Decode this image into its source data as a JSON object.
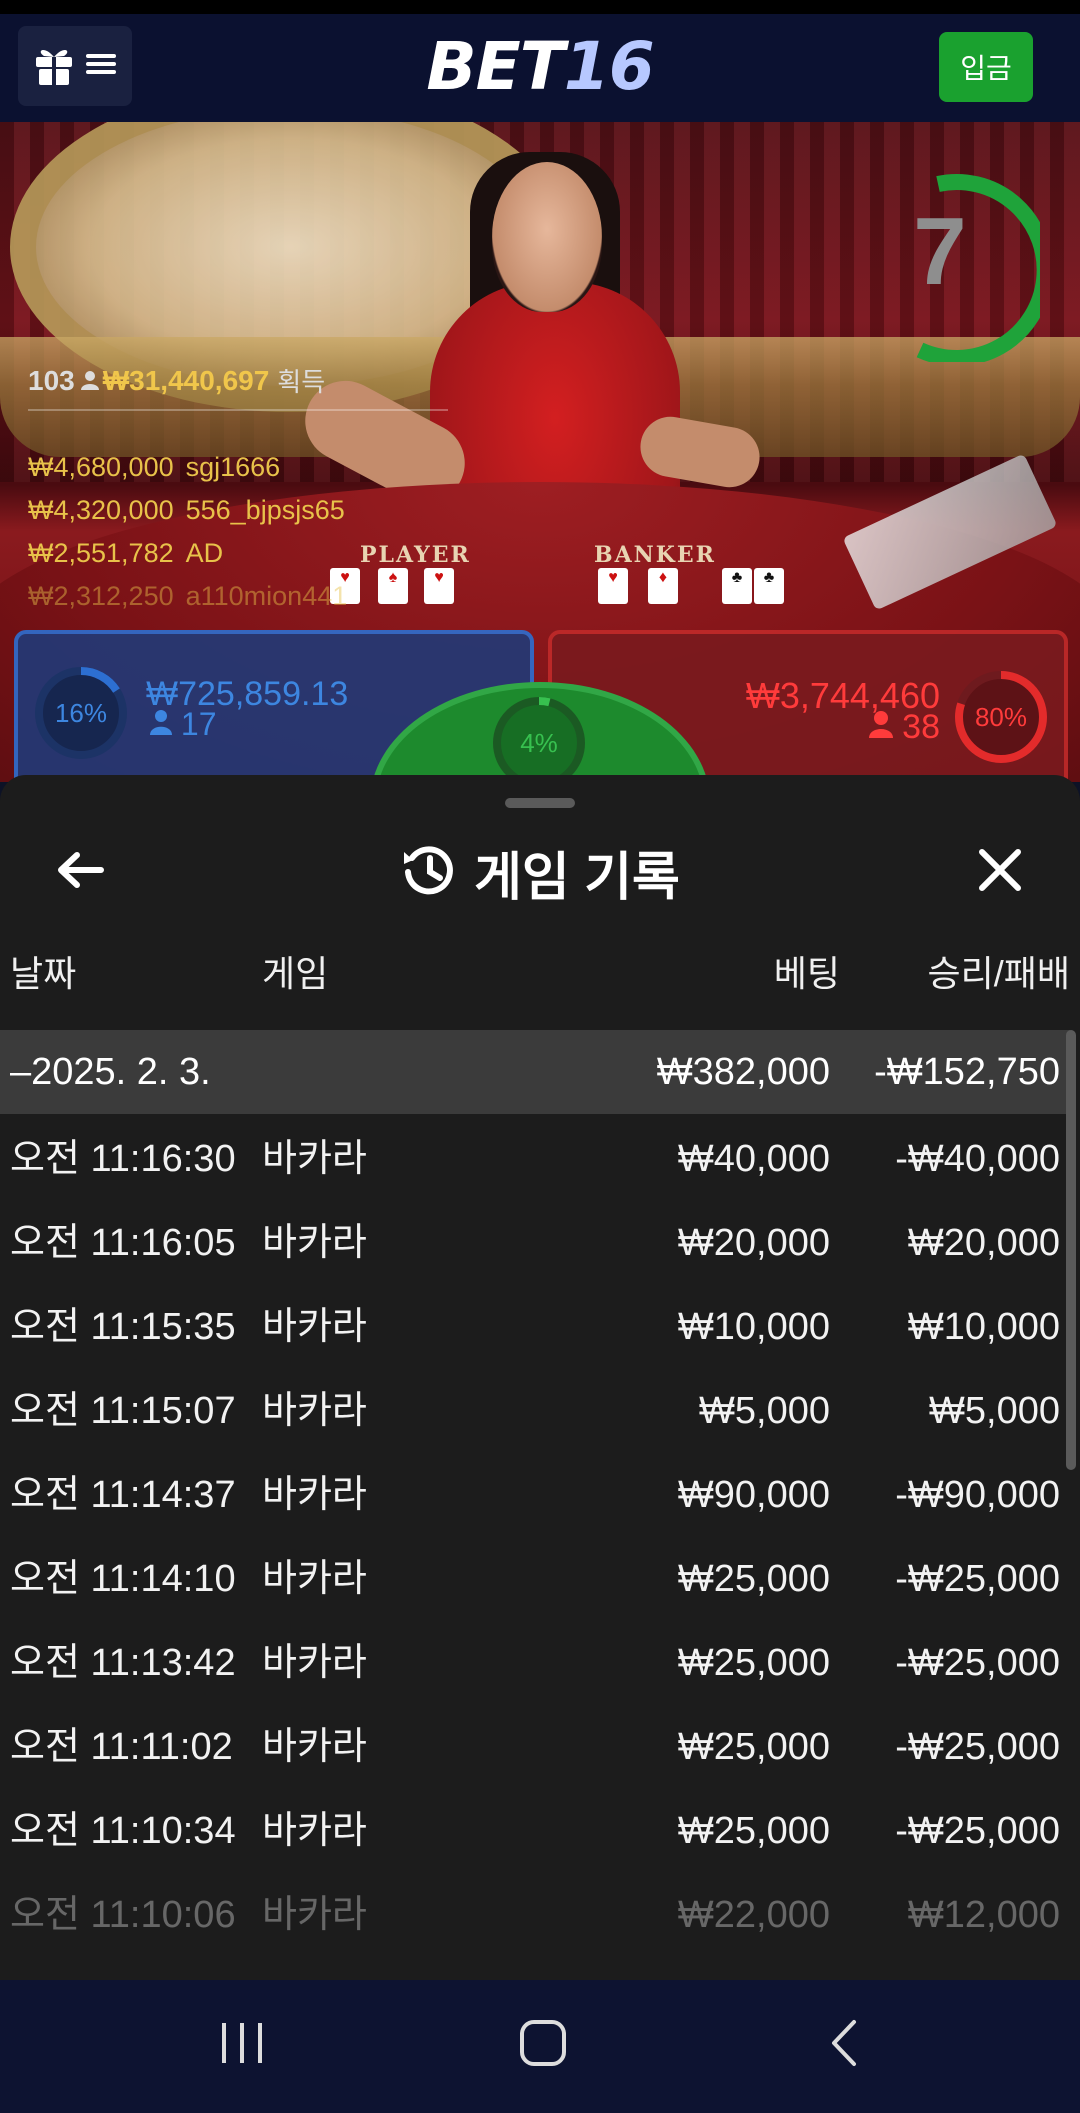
{
  "header": {
    "logo_bet": "BET",
    "logo_num": "16",
    "deposit_label": "입금"
  },
  "video": {
    "timer": "7",
    "table_player_label": "PLAYER",
    "table_banker_label": "BANKER",
    "winners": {
      "count": "103",
      "total": "₩31,440,697",
      "total_label": "획득",
      "list": [
        {
          "amount": "₩4,680,000",
          "name": "sgj1666"
        },
        {
          "amount": "₩4,320,000",
          "name": "556_bjpsjs65"
        },
        {
          "amount": "₩2,551,782",
          "name": "AD"
        },
        {
          "amount": "₩2,312,250",
          "name": "a110mion441"
        }
      ]
    },
    "player_bet": {
      "percent_label": "16%",
      "percent": 16,
      "amount": "₩725,859.13",
      "count": "17"
    },
    "tie_bet": {
      "percent_label": "4%",
      "percent": 4
    },
    "banker_bet": {
      "percent_label": "80%",
      "percent": 80,
      "amount": "₩3,744,460",
      "count": "38"
    },
    "colors": {
      "player": "#2d6fd1",
      "banker": "#c12a2a",
      "tie": "#31a746",
      "timer": "#1fa33a",
      "gold": "#f0c64b"
    }
  },
  "history": {
    "title": "게임 기록",
    "columns": {
      "date": "날짜",
      "game": "게임",
      "bet": "베팅",
      "result": "승리/패배"
    },
    "date_group": {
      "label": "–2025. 2. 3.",
      "bet": "₩382,000",
      "result": "-₩152,750"
    },
    "rows": [
      {
        "time": "오전 11:16:30",
        "game": "바카라",
        "bet": "₩40,000",
        "result": "-₩40,000"
      },
      {
        "time": "오전 11:16:05",
        "game": "바카라",
        "bet": "₩20,000",
        "result": "₩20,000"
      },
      {
        "time": "오전 11:15:35",
        "game": "바카라",
        "bet": "₩10,000",
        "result": "₩10,000"
      },
      {
        "time": "오전 11:15:07",
        "game": "바카라",
        "bet": "₩5,000",
        "result": "₩5,000"
      },
      {
        "time": "오전 11:14:37",
        "game": "바카라",
        "bet": "₩90,000",
        "result": "-₩90,000"
      },
      {
        "time": "오전 11:14:10",
        "game": "바카라",
        "bet": "₩25,000",
        "result": "-₩25,000"
      },
      {
        "time": "오전 11:13:42",
        "game": "바카라",
        "bet": "₩25,000",
        "result": "-₩25,000"
      },
      {
        "time": "오전 11:11:02",
        "game": "바카라",
        "bet": "₩25,000",
        "result": "-₩25,000"
      },
      {
        "time": "오전 11:10:34",
        "game": "바카라",
        "bet": "₩25,000",
        "result": "-₩25,000"
      },
      {
        "time": "오전 11:10:06",
        "game": "바카라",
        "bet": "₩22,000",
        "result": "₩12,000"
      }
    ]
  },
  "icons": {
    "gift": "gift-icon",
    "menu": "menu-icon",
    "back": "arrow-left-icon",
    "history": "history-icon",
    "close": "close-icon",
    "nav_recents": "recents-icon",
    "nav_home": "home-icon",
    "nav_back": "nav-back-icon"
  }
}
